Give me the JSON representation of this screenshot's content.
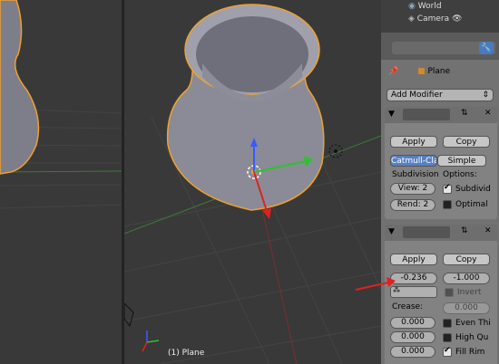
{
  "outliner": {
    "items": [
      "World",
      "Camera"
    ]
  },
  "properties": {
    "context_label": "Plane",
    "add_modifier": "Add Modifier",
    "subsurf": {
      "apply": "Apply",
      "copy": "Copy",
      "algo_catmull": "Catmull-Clar",
      "algo_simple": "Simple",
      "subdivisions_label": "Subdivision",
      "options_label": "Options:",
      "view": "View: 2",
      "render": "Rend: 2",
      "subdivide_uvs": "Subdivid",
      "optimal_display": "Optimal"
    },
    "solidify": {
      "apply": "Apply",
      "copy": "Copy",
      "thickness": "-0.236",
      "offset": "-1.000",
      "invert": "Invert",
      "crease_label": "Crease:",
      "crease_top": "0.000",
      "crease_inner": "0.000",
      "crease_outer": "0.000",
      "crease_rim": "0.000",
      "even_thickness": "Even Thi",
      "high_quality": "High Qu",
      "fill_rim": "Fill Rim"
    }
  },
  "viewport": {
    "object_label": "(1) Plane"
  },
  "colors": {
    "select_orange": "#f0a030",
    "active_blue": "#5680c2",
    "annotation_red": "#e02020"
  }
}
